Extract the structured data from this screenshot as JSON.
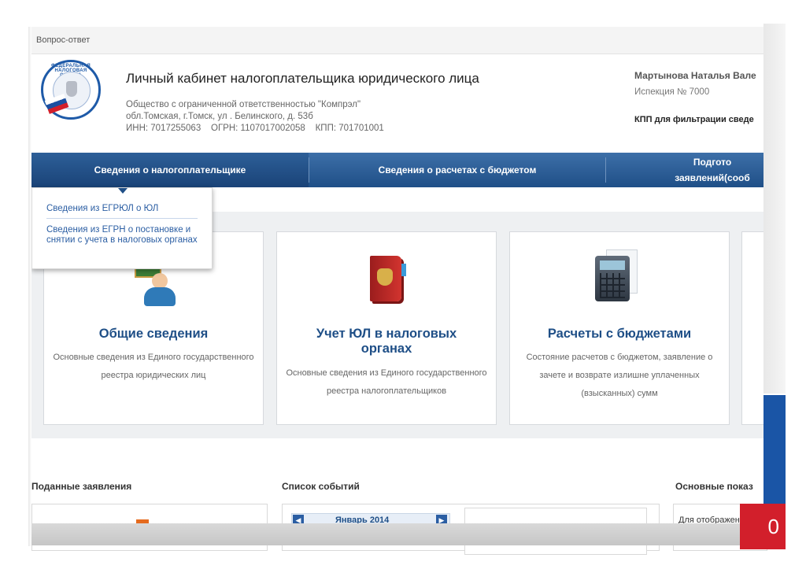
{
  "topbar": {
    "link": "Вопрос-ответ"
  },
  "logo": {
    "ring_text": "ФЕДЕРАЛЬНАЯ НАЛОГОВАЯ СЛУЖБА"
  },
  "header": {
    "title": "Личный кабинет налогоплательщика юридического лица",
    "org_name": "Общество с ограниченной ответственностью \"Компрэл\"",
    "org_address": "обл.Томская, г.Томск, ул . Белинского, д. 53б",
    "org_ids": "ИНН: 7017255063    ОГРН: 1107017002058    КПП: 701701001",
    "user_name": "Мартынова Наталья Вале",
    "inspection": "Испекция № 7000",
    "kpp_filter": "КПП для фильтрации сведе"
  },
  "nav": {
    "items": [
      {
        "label": "Сведения о налогоплательщике"
      },
      {
        "label": "Сведения о расчетах с бюджетом"
      },
      {
        "label": "Подгото заявлений(сооб"
      }
    ]
  },
  "dropdown": {
    "items": [
      {
        "label": "Сведения из ЕГРЮЛ о ЮЛ"
      },
      {
        "label": "Сведения из ЕГРН о постановке и снятии с учета в налоговых органах"
      }
    ]
  },
  "cards": [
    {
      "title": "Общие сведения",
      "desc": "Основные сведения из Единого государственного реестра юридических лиц",
      "icon": "teacher-icon"
    },
    {
      "title": "Учет ЮЛ в налоговых органах",
      "desc": "Основные сведения из Единого государственного реестра налогоплательщиков",
      "icon": "passport-book-icon"
    },
    {
      "title": "Расчеты с бюджетами",
      "desc": "Состояние расчетов с бюджетом, заявление о зачете и возврате излишне уплаченных (взысканных) сумм",
      "icon": "calculator-icon"
    }
  ],
  "bottom": {
    "submitted_title": "Поданные заявления",
    "events_title": "Список событий",
    "calendar_month": "Январь 2014",
    "indicators_title": "Основные показ",
    "indicators_hint": "Для отображения и"
  },
  "slide_number": "0",
  "colors": {
    "nav_blue": "#1f4f87",
    "title_blue": "#1f4f87",
    "link_blue": "#2b5ea3",
    "accent_red": "#d21f2b",
    "accent_orange": "#e56b1f"
  }
}
